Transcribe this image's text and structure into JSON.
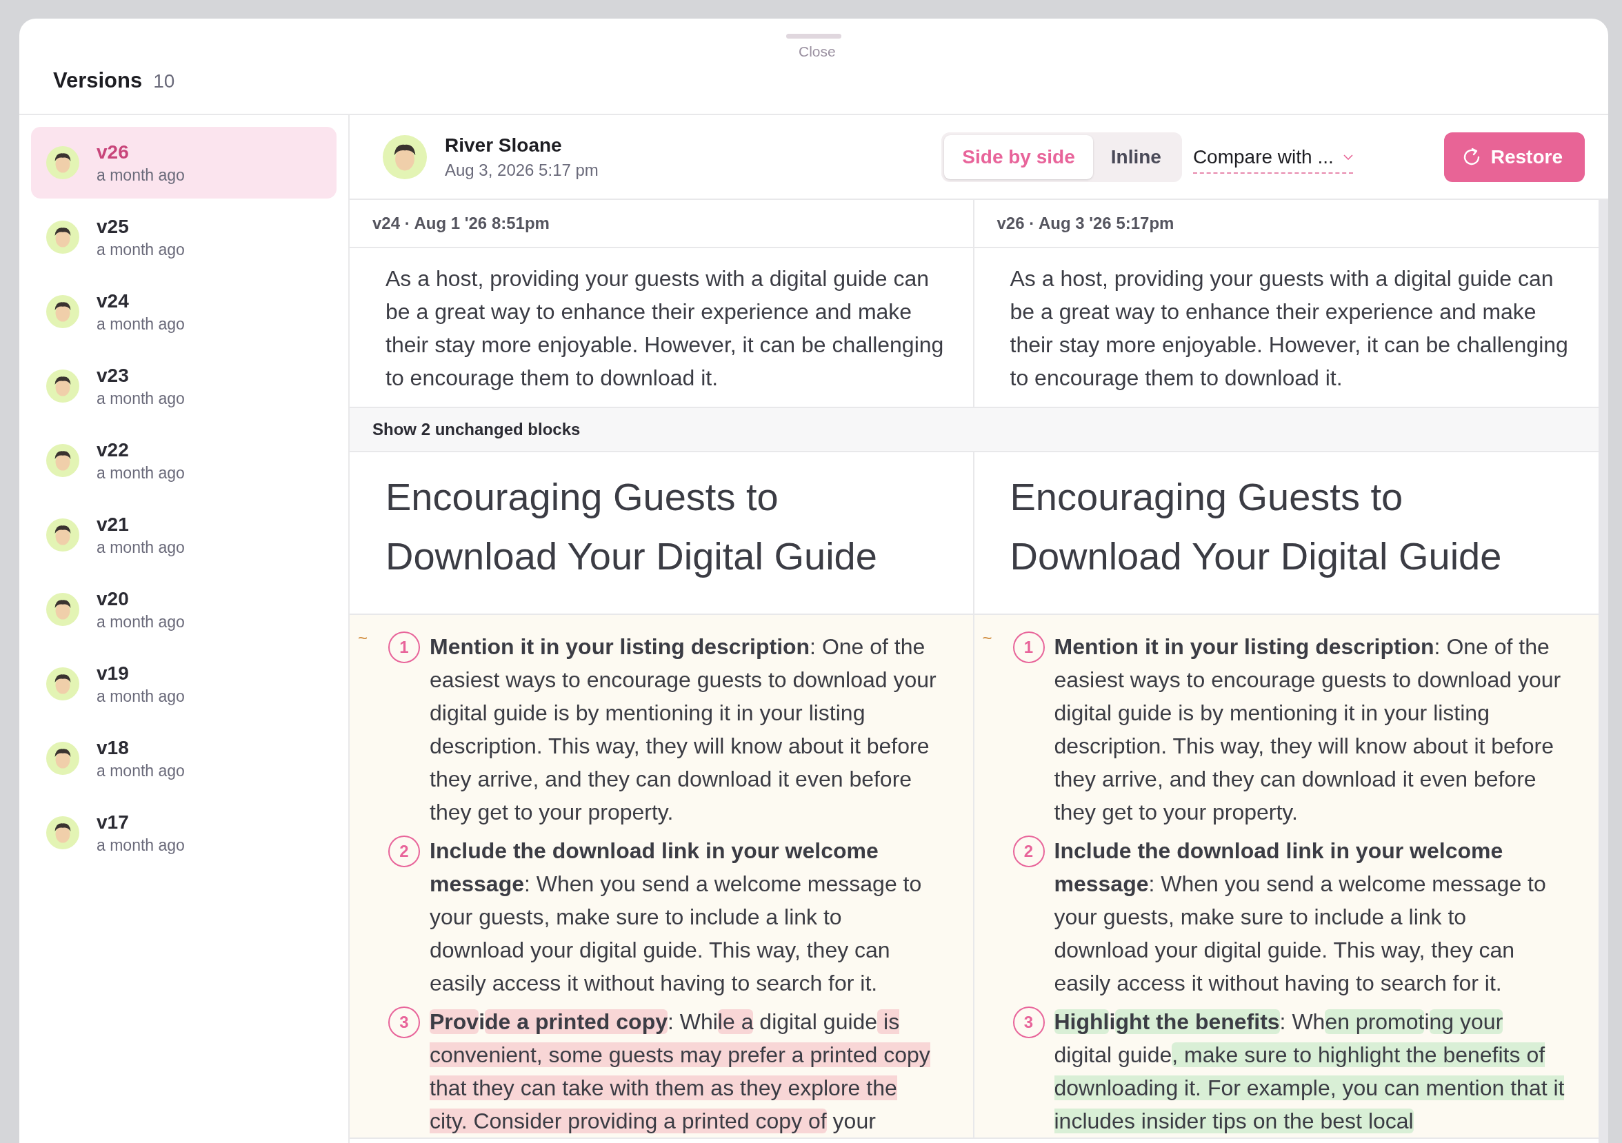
{
  "modal": {
    "close_label": "Close",
    "title": "Versions",
    "count": "10"
  },
  "versions": [
    {
      "label": "v26",
      "time": "a month ago",
      "selected": true
    },
    {
      "label": "v25",
      "time": "a month ago",
      "selected": false
    },
    {
      "label": "v24",
      "time": "a month ago",
      "selected": false
    },
    {
      "label": "v23",
      "time": "a month ago",
      "selected": false
    },
    {
      "label": "v22",
      "time": "a month ago",
      "selected": false
    },
    {
      "label": "v21",
      "time": "a month ago",
      "selected": false
    },
    {
      "label": "v20",
      "time": "a month ago",
      "selected": false
    },
    {
      "label": "v19",
      "time": "a month ago",
      "selected": false
    },
    {
      "label": "v18",
      "time": "a month ago",
      "selected": false
    },
    {
      "label": "v17",
      "time": "a month ago",
      "selected": false
    }
  ],
  "header": {
    "author": "River Sloane",
    "date": "Aug 3, 2026 5:17 pm",
    "view_modes": [
      {
        "label": "Side by side",
        "selected": true
      },
      {
        "label": "Inline",
        "selected": false
      }
    ],
    "compare": "Compare with ...",
    "restore": "Restore"
  },
  "columns": [
    {
      "label": "v24 · Aug 1 '26 8:51pm"
    },
    {
      "label": "v26 · Aug 3 '26 5:17pm"
    }
  ],
  "blocks": [
    {
      "kind": "paragraph",
      "cells": [
        "As a host, providing your guests with a digital guide can be a great way to enhance their experience and make their stay more enjoyable. However, it can be challenging to encourage them to download it.",
        "As a host, providing your guests with a digital guide can be a great way to enhance their experience and make their stay more enjoyable. However, it can be challenging to encourage them to download it."
      ]
    },
    {
      "kind": "collapsed",
      "label": "Show 2 unchanged blocks"
    },
    {
      "kind": "heading",
      "cells": [
        "Encouraging Guests to Download Your Digital Guide",
        "Encouraging Guests to Download Your Digital Guide"
      ]
    },
    {
      "kind": "list",
      "marker": "~",
      "cells": [
        {
          "kind": "old",
          "items": [
            {
              "number": "1",
              "segments": [
                {
                  "text": "Mention it in your listing description",
                  "bold": true,
                  "changed": false
                },
                {
                  "text": ": One of the easiest ways to encourage guests to download your digital guide is by mentioning it in your listing description. This way, they will know about it before they arrive, and they can download it even before they get to your property.",
                  "bold": false,
                  "changed": false
                }
              ]
            },
            {
              "number": "2",
              "segments": [
                {
                  "text": "Include the download link in your welcome message",
                  "bold": true,
                  "changed": false
                },
                {
                  "text": ": When you send a welcome message to your guests, make sure to include a link to download your digital guide. This way, they can easily access it without having to search for it.",
                  "bold": false,
                  "changed": false
                }
              ]
            },
            {
              "number": "3",
              "segments": [
                {
                  "text": "Prov",
                  "bold": true,
                  "changed": true
                },
                {
                  "text": "i",
                  "bold": true,
                  "changed": false
                },
                {
                  "text": "de a printed copy",
                  "bold": true,
                  "changed": true
                },
                {
                  "text": ": Whi",
                  "bold": false,
                  "changed": false
                },
                {
                  "text": "le a",
                  "bold": false,
                  "changed": true
                },
                {
                  "text": " digital guide",
                  "bold": false,
                  "changed": false
                },
                {
                  "text": " is convenient, some guests may prefer a printed copy that they can take with them as they explore the city. Consider providing a printed copy of",
                  "bold": false,
                  "changed": true
                },
                {
                  "text": " your",
                  "bold": false,
                  "changed": false
                }
              ]
            }
          ]
        },
        {
          "kind": "new",
          "items": [
            {
              "number": "1",
              "segments": [
                {
                  "text": "Mention it in your listing description",
                  "bold": true,
                  "changed": false
                },
                {
                  "text": ": One of the easiest ways to encourage guests to download your digital guide is by mentioning it in your listing description. This way, they will know about it before they arrive, and they can download it even before they get to your property.",
                  "bold": false,
                  "changed": false
                }
              ]
            },
            {
              "number": "2",
              "segments": [
                {
                  "text": "Include the download link in your welcome message",
                  "bold": true,
                  "changed": false
                },
                {
                  "text": ": When you send a welcome message to your guests, make sure to include a link to download your digital guide. This way, they can easily access it without having to search for it.",
                  "bold": false,
                  "changed": false
                }
              ]
            },
            {
              "number": "3",
              "segments": [
                {
                  "text": "Highl",
                  "bold": true,
                  "changed": true
                },
                {
                  "text": "i",
                  "bold": true,
                  "changed": false
                },
                {
                  "text": "ght the benefits",
                  "bold": true,
                  "changed": true
                },
                {
                  "text": ": Wh",
                  "bold": false,
                  "changed": false
                },
                {
                  "text": "en promot",
                  "bold": false,
                  "changed": true
                },
                {
                  "text": "i",
                  "bold": false,
                  "changed": false
                },
                {
                  "text": "ng your",
                  "bold": false,
                  "changed": true
                },
                {
                  "text": " digital guide",
                  "bold": false,
                  "changed": false
                },
                {
                  "text": ", make sure to highlight the benefits of downloading it. For example, you can mention that it includes insider tips on the best local",
                  "bold": false,
                  "changed": true
                }
              ]
            }
          ]
        }
      ]
    }
  ]
}
